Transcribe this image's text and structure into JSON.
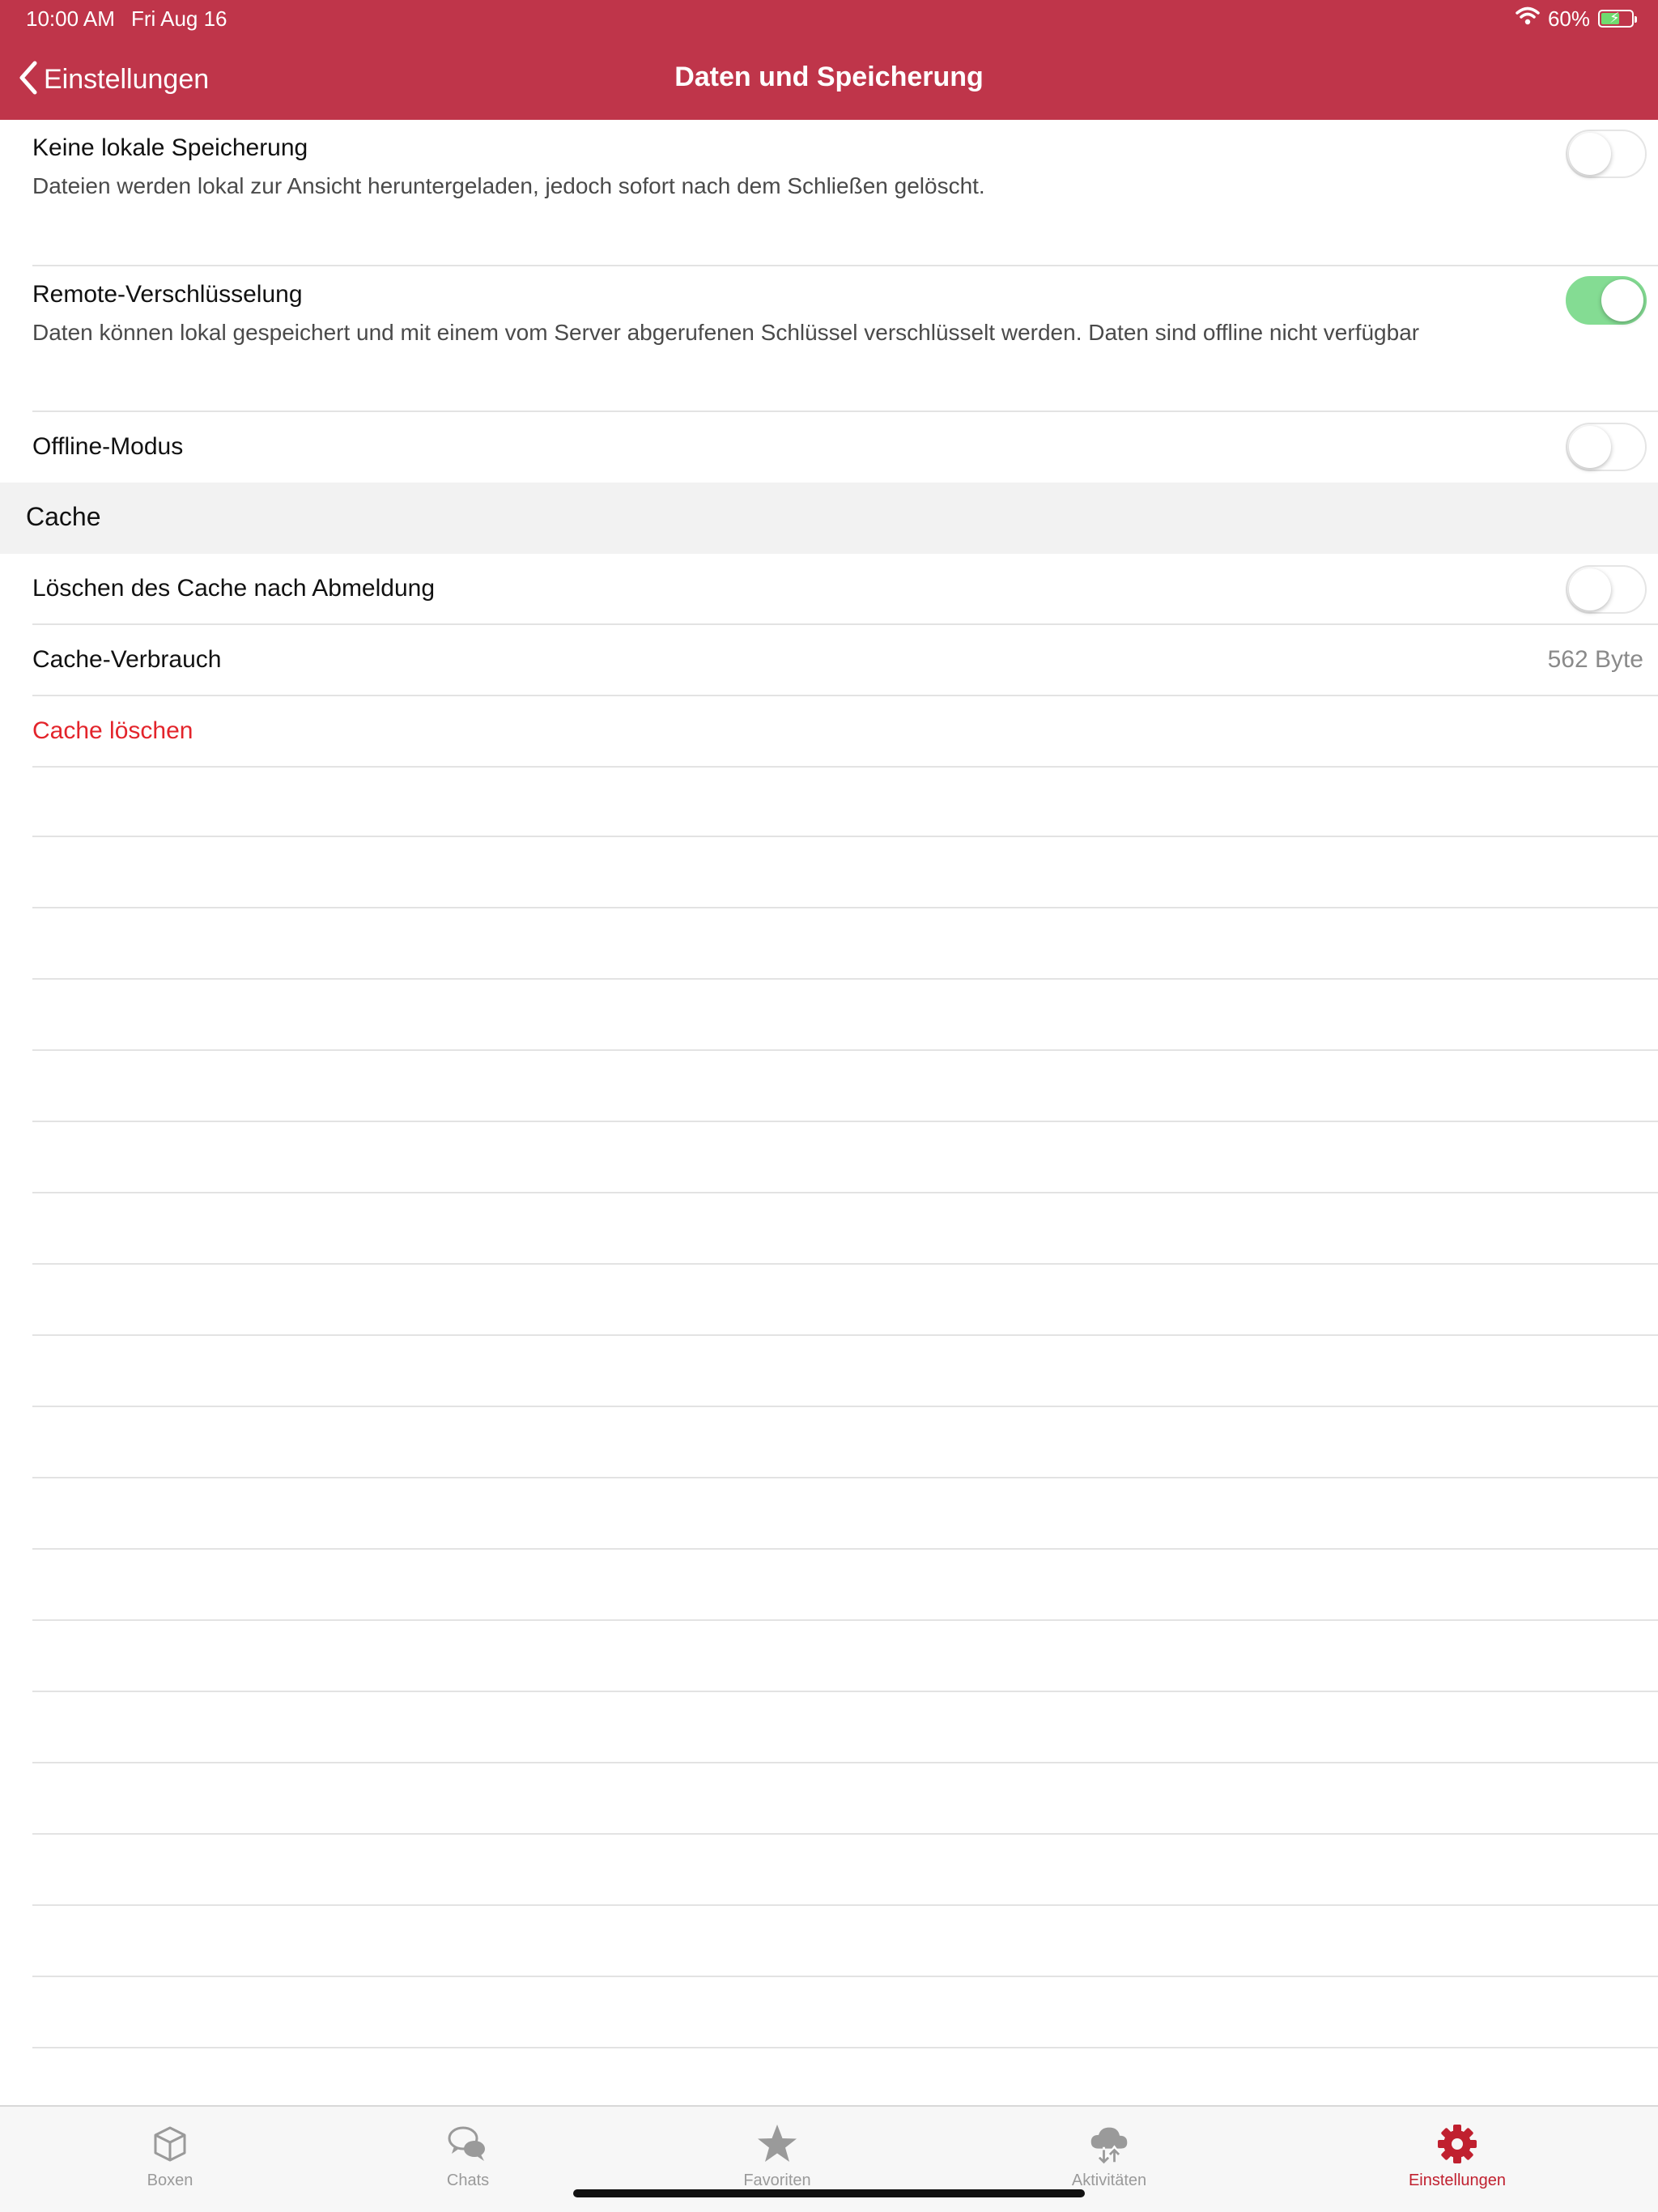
{
  "status_bar": {
    "time": "10:00 AM",
    "date": "Fri Aug 16",
    "battery_text": "60%",
    "battery_level": 0.6,
    "wifi_icon": "wifi-icon",
    "battery_icon": "battery-charging-icon"
  },
  "nav": {
    "back_label": "Einstellungen",
    "title": "Daten und Speicherung",
    "back_icon": "chevron-left-icon"
  },
  "settings": {
    "no_local_storage": {
      "title": "Keine lokale Speicherung",
      "subtitle": "Dateien werden lokal zur Ansicht heruntergeladen, jedoch sofort nach dem Schließen gelöscht.",
      "enabled": false
    },
    "remote_encryption": {
      "title": "Remote-Verschlüsselung",
      "subtitle": "Daten können lokal gespeichert und mit einem vom Server abgerufenen Schlüssel verschlüsselt werden. Daten sind offline nicht verfügbar",
      "enabled": true
    },
    "offline_mode": {
      "title": "Offline-Modus",
      "enabled": false
    }
  },
  "cache": {
    "section_title": "Cache",
    "clear_on_logout": {
      "title": "Löschen des Cache nach Abmeldung",
      "enabled": false
    },
    "usage": {
      "title": "Cache-Verbrauch",
      "value": "562 Byte"
    },
    "clear_action": "Cache löschen"
  },
  "tabbar": {
    "items": [
      {
        "label": "Boxen",
        "icon": "box-icon",
        "active": false
      },
      {
        "label": "Chats",
        "icon": "chat-bubbles-icon",
        "active": false
      },
      {
        "label": "Favoriten",
        "icon": "star-icon",
        "active": false
      },
      {
        "label": "Aktivitäten",
        "icon": "cloud-sync-icon",
        "active": false
      },
      {
        "label": "Einstellungen",
        "icon": "gear-icon",
        "active": true
      }
    ]
  },
  "colors": {
    "brand": "#bf354a",
    "toggle_on": "#84dc93",
    "danger": "#e3242b",
    "active_tab": "#c0202f",
    "inactive_tab": "#9a9a9a"
  }
}
